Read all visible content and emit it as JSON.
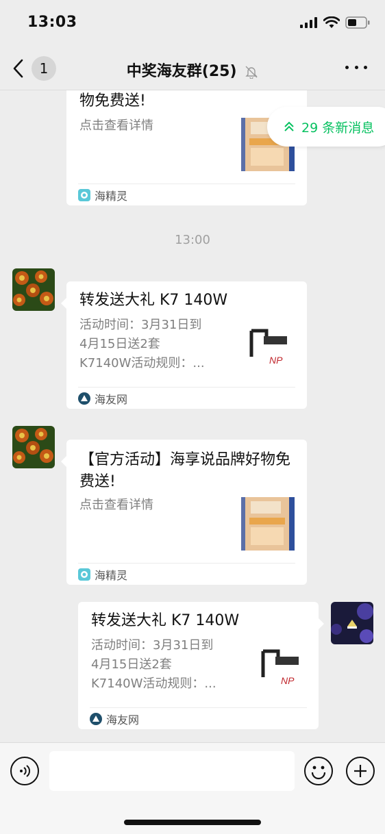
{
  "status_bar": {
    "time": "13:03"
  },
  "nav": {
    "back_badge": "1",
    "title": "中奖海友群(25)"
  },
  "new_messages": {
    "label": "29 条新消息"
  },
  "messages": [
    {
      "title": "物免费送!",
      "desc": "点击查看详情",
      "source": "海精灵"
    },
    {
      "time": "13:00"
    },
    {
      "title": "转发送大礼 K7 140W",
      "desc": "活动时间：3月31日到\n4月15日送2套\nK7140W活动规则：...",
      "source": "海友网"
    },
    {
      "title": "【官方活动】海享说品牌好物免费送!",
      "desc": "点击查看详情",
      "source": "海精灵"
    },
    {
      "title": "转发送大礼 K7 140W",
      "desc": "活动时间：3月31日到\n4月15日送2套\nK7140W活动规则：...",
      "source": "海友网"
    }
  ],
  "colors": {
    "accent": "#07c160",
    "background": "#ededed"
  }
}
